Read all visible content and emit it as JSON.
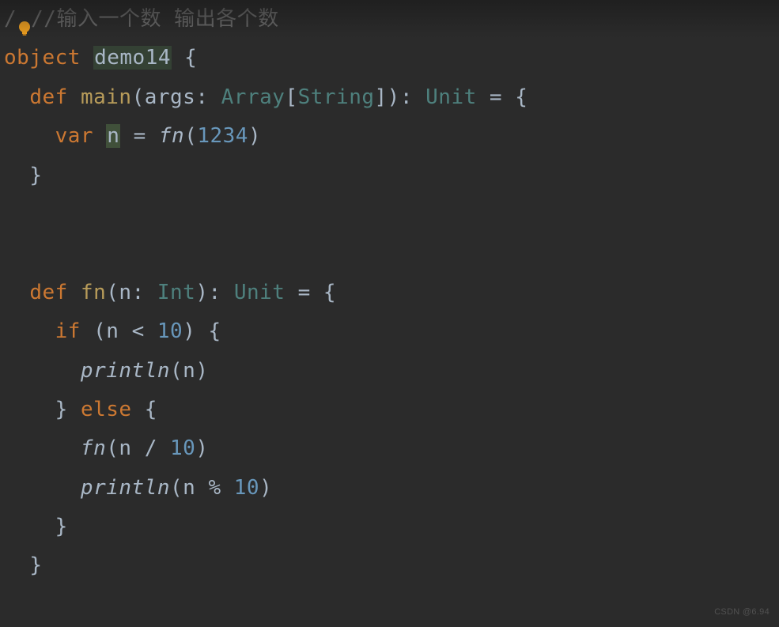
{
  "editor": {
    "comment_line": "//输入一个数 输出各个数",
    "object_keyword": "object",
    "object_name": "demo14",
    "open_brace": "{",
    "close_brace": "}",
    "def_keyword": "def",
    "main_name": "main",
    "args_name": "args",
    "array_type": "Array",
    "string_type": "String",
    "unit_type": "Unit",
    "eq": "=",
    "var_keyword": "var",
    "var_n": "n",
    "fn_name": "fn",
    "fn_arg_val": "1234",
    "colon": ":",
    "int_type": "Int",
    "if_keyword": "if",
    "else_keyword": "else",
    "lt_ten": "10",
    "println_name": "println",
    "div_op": "/",
    "mod_op": "%",
    "lparen": "(",
    "rparen": ")",
    "lbracket": "[",
    "rbracket": "]"
  },
  "watermark": "CSDN @6.94",
  "icons": {
    "bulb": "intention-bulb-icon"
  }
}
